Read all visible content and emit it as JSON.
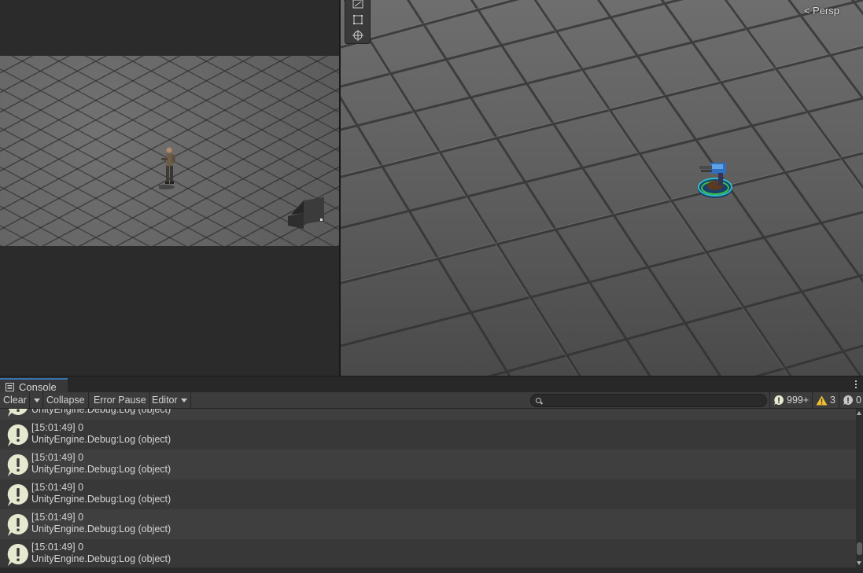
{
  "scene": {
    "persp_label": "< Persp"
  },
  "console": {
    "tab_label": "Console",
    "toolbar": {
      "clear": "Clear",
      "collapse": "Collapse",
      "error_pause": "Error Pause",
      "editor": "Editor"
    },
    "search": {
      "value": "",
      "placeholder": ""
    },
    "counts": {
      "info": "999+",
      "warnings": "3",
      "errors": "0"
    },
    "partial_entry": "UnityEngine.Debug:Log (object)",
    "entries": [
      {
        "line1": "[15:01:49] 0",
        "line2": "UnityEngine.Debug:Log (object)"
      },
      {
        "line1": "[15:01:49] 0",
        "line2": "UnityEngine.Debug:Log (object)"
      },
      {
        "line1": "[15:01:49] 0",
        "line2": "UnityEngine.Debug:Log (object)"
      },
      {
        "line1": "[15:01:49] 0",
        "line2": "UnityEngine.Debug:Log (object)"
      },
      {
        "line1": "[15:01:49] 0",
        "line2": "UnityEngine.Debug:Log (object)"
      }
    ]
  },
  "colors": {
    "accent_tab": "#3a72b0",
    "info_icon": "#e6e8cf",
    "warning_icon": "#f2c12e"
  },
  "icons": {
    "tab": "console-icon",
    "info": "info-bubble-icon",
    "warning": "warning-triangle-icon",
    "error": "error-bubble-icon"
  }
}
